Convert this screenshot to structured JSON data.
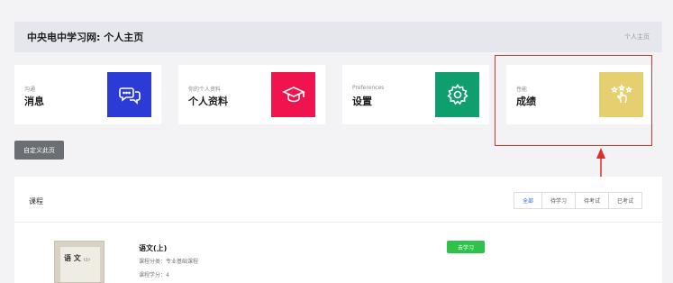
{
  "header": {
    "title": "中央电中学习网: 个人主页",
    "breadcrumb": "个人主页"
  },
  "cards": [
    {
      "subtitle": "沟通",
      "label": "消息",
      "icon": "chat-bubbles-icon",
      "color": "#2a3bd6"
    },
    {
      "subtitle": "你的个人资料",
      "label": "个人资料",
      "icon": "graduation-cap-icon",
      "color": "#f0134e"
    },
    {
      "subtitle": "Preferences",
      "label": "设置",
      "icon": "gear-icon",
      "color": "#0f9e6e"
    },
    {
      "subtitle": "性能",
      "label": "成绩",
      "icon": "hand-stars-icon",
      "color": "#e6cf6f"
    }
  ],
  "custom_button": "自定义此页",
  "courses": {
    "heading": "课程",
    "filters": [
      "全部",
      "待学习",
      "待考试",
      "已考试"
    ],
    "active_filter": "全部",
    "items": [
      {
        "thumbnail_title": "语 文",
        "thumbnail_note": "(上)",
        "name": "语文(上)",
        "category": "课程分类：专业基础课程",
        "credits": "课程学分：4",
        "action": "去学习"
      }
    ]
  }
}
